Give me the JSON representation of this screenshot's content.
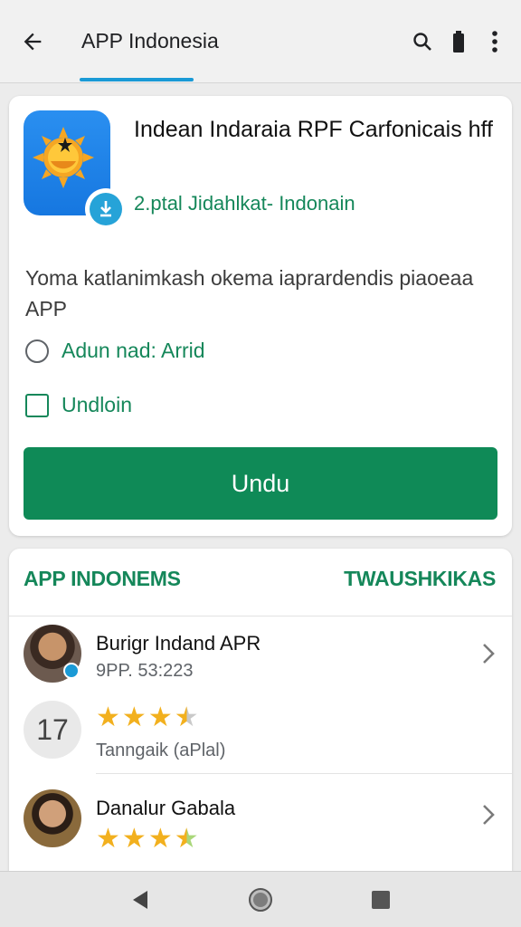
{
  "appbar": {
    "title": "APP Indonesia",
    "back_icon": "arrow-back-icon",
    "actions": [
      "search-icon",
      "battery-icon",
      "more-vert-icon"
    ],
    "accent": "#1a9ad6"
  },
  "app": {
    "name": "Indean Indaraia RPF Carfonicais hff",
    "developer": "2.ptal Jidahlkat- Indonain",
    "icon": "sun-app-icon",
    "description": "Yoma katlanimkash okema iaprardendis piaoeaa APP",
    "option_radio_label": "Adun nad: Arrid",
    "option_checkbox_label": "Undloin",
    "install_label": "Undu"
  },
  "section": {
    "title": "APP INDONEMS",
    "action": "TWAUSHKIKAS",
    "rows": [
      {
        "title": "Burigr Indand APR",
        "subtitle": "9PP. 53:223",
        "icon": "avatar"
      },
      {
        "number": "17",
        "subtitle": "Tanngaik (aPlal)",
        "rating": 3.5
      },
      {
        "title": "Danalur Gabala",
        "rating": 3.5,
        "icon": "avatar"
      }
    ]
  },
  "colors": {
    "brand_green": "#0f8a57",
    "text_green": "#15875a",
    "star": "#f2b01e"
  },
  "navbar": [
    "back-triangle-icon",
    "home-circle-icon",
    "recents-square-icon"
  ]
}
